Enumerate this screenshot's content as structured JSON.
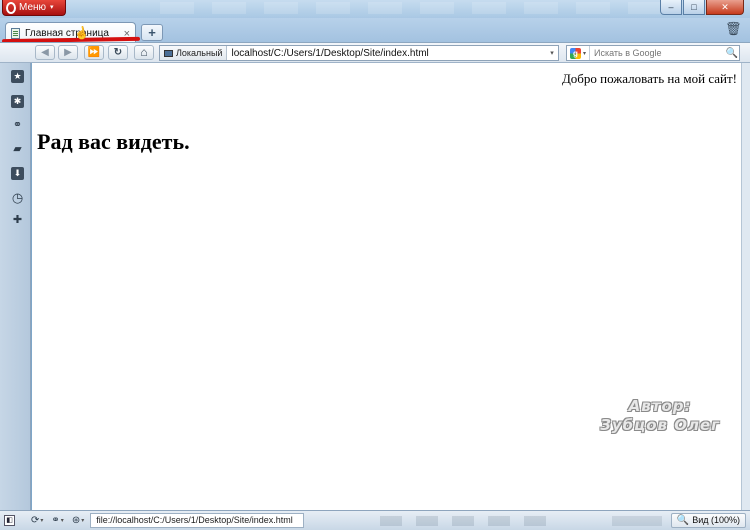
{
  "window": {
    "menu_label": "Меню",
    "menu_caret": "▾",
    "minimize_glyph": "–",
    "maximize_glyph": "□",
    "close_glyph": "✕"
  },
  "tabs": [
    {
      "label": "Главная страница",
      "close_glyph": "×",
      "active": true
    }
  ],
  "new_tab_glyph": "+",
  "trash_glyph": "🗑",
  "navigation": {
    "back_glyph": "◀",
    "forward_glyph": "▶",
    "fast_forward_glyph": "⏩",
    "reload_glyph": "↻",
    "home_glyph": "⌂"
  },
  "address_bar": {
    "security_label": "Локальный",
    "url": "localhost/C:/Users/1/Desktop/Site/index.html",
    "dropdown_glyph": "▾"
  },
  "search": {
    "engine_letter": "g",
    "placeholder": "Искать в Google",
    "go_glyph": "🔍"
  },
  "sidebar": {
    "items": [
      {
        "name": "bookmarks",
        "glyph": "★"
      },
      {
        "name": "widgets",
        "glyph": "✱"
      },
      {
        "name": "unite",
        "glyph": "⚭"
      },
      {
        "name": "notes",
        "glyph": "▰"
      },
      {
        "name": "downloads",
        "glyph": "⬇"
      },
      {
        "name": "history",
        "glyph": "◷"
      },
      {
        "name": "add-panel",
        "glyph": "✚"
      }
    ]
  },
  "page": {
    "welcome_text": "Добро пожаловать на мой сайт!",
    "heading": "Рад вас видеть."
  },
  "watermark": {
    "line1": "Автор:",
    "line2": "Зубцов Олег"
  },
  "status_bar": {
    "panel_glyph": "◧",
    "sync_glyph": "⟳",
    "unite_glyph": "⚭",
    "turbo_glyph": "⊛",
    "url": "file://localhost/C:/Users/1/Desktop/Site/index.html",
    "zoom_label": "Вид (100%)",
    "zoom_glyph": "🔍"
  },
  "colors": {
    "menu_red": "#c21a14",
    "annotation_red": "#d41010",
    "frame_blue": "#a9c8e4"
  }
}
